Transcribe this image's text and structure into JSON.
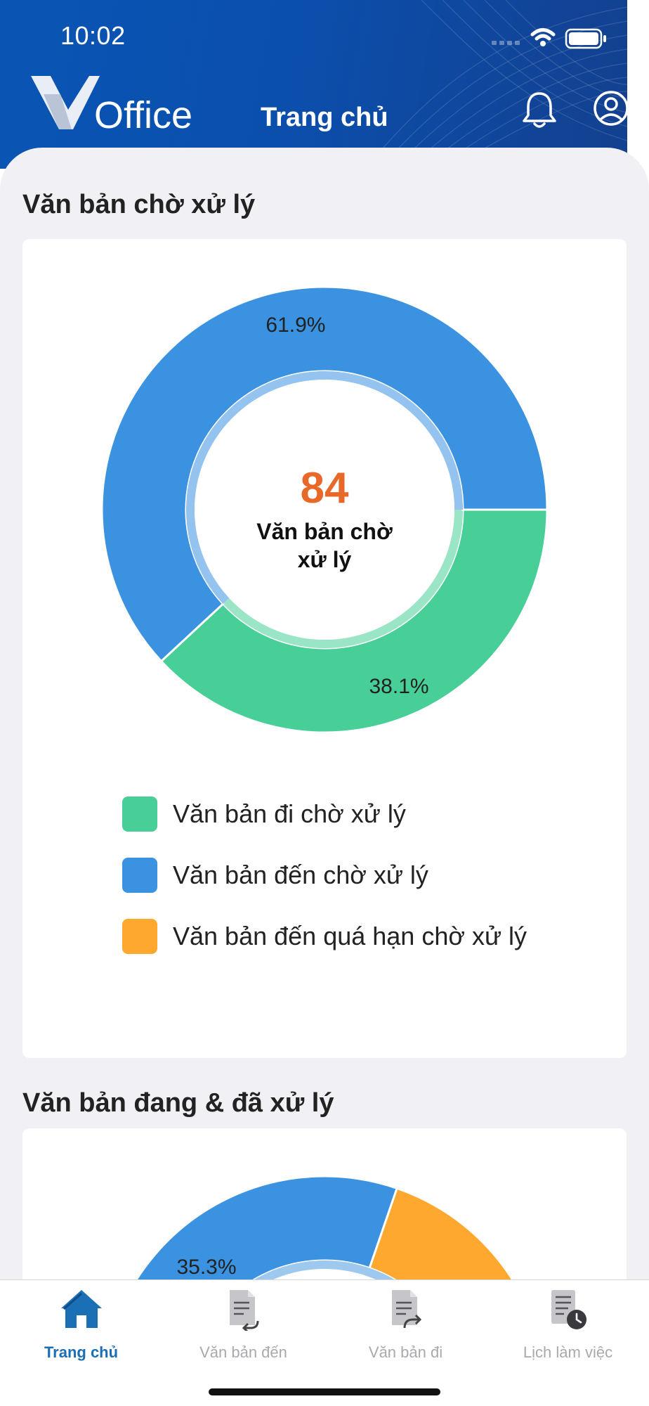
{
  "status_bar": {
    "time": "10:02"
  },
  "header": {
    "logo_text": "Office",
    "title": "Trang chủ"
  },
  "pending_section": {
    "title": "Văn bản chờ xử lý",
    "center_count": "84",
    "center_label_line1": "Văn bản chờ",
    "center_label_line2": "xử lý",
    "chart_data": {
      "type": "pie",
      "title": "",
      "categories": [
        "Văn bản đi chờ xử lý",
        "Văn bản đến chờ xử lý",
        "Văn bản đến quá hạn chờ xử lý"
      ],
      "values": [
        38.1,
        61.9,
        0
      ],
      "value_labels": [
        "38.1%",
        "61.9%",
        ""
      ],
      "colors": [
        "#47cf97",
        "#3a92e0",
        "#fea82f"
      ],
      "legend_position": "bottom"
    }
  },
  "legend": {
    "items": [
      {
        "label": "Văn bản đi chờ xử lý",
        "color": "#47cf97"
      },
      {
        "label": "Văn bản đến chờ xử lý",
        "color": "#3a92e0"
      },
      {
        "label": "Văn bản đến quá hạn chờ xử lý",
        "color": "#fea82f"
      }
    ]
  },
  "processed_section": {
    "title": "Văn bản đang & đã xử lý",
    "visible_value_label": "35.3%",
    "chart_data": {
      "type": "pie",
      "title": "",
      "visible_segments": [
        {
          "color": "#3a92e0",
          "value": 35.3,
          "label": "35.3%"
        },
        {
          "color": "#fea82f"
        }
      ]
    }
  },
  "tabbar": {
    "tabs": [
      {
        "label": "Trang chủ",
        "icon": "home-icon",
        "active": true
      },
      {
        "label": "Văn bản đến",
        "icon": "incoming-document-icon",
        "active": false
      },
      {
        "label": "Văn bản đi",
        "icon": "outgoing-document-icon",
        "active": false
      },
      {
        "label": "Lịch làm việc",
        "icon": "calendar-schedule-icon",
        "active": false
      }
    ]
  },
  "colors": {
    "header_blue": "#0b4fad",
    "accent_orange": "#e8682a",
    "active_tab": "#1b6fb5",
    "inactive_tab": "#a9a9ae"
  }
}
